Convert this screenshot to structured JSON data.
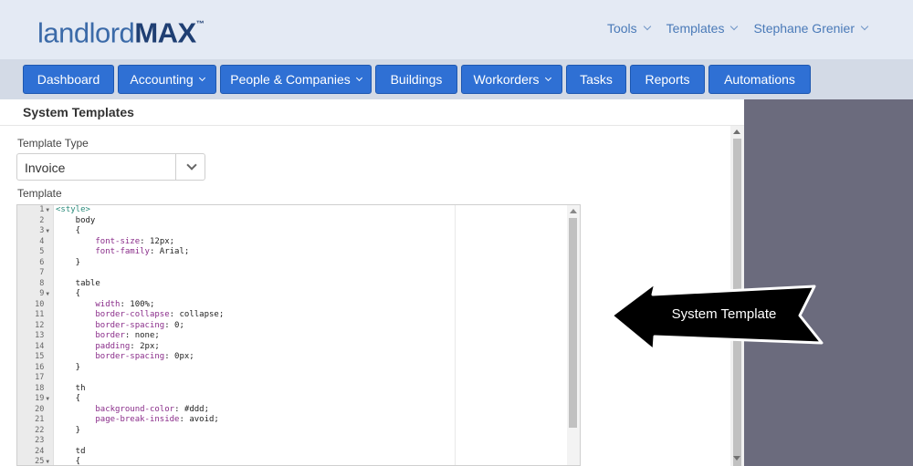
{
  "logo": {
    "light": "landlord",
    "bold": "MAX",
    "tm": "™"
  },
  "top_menu": [
    {
      "label": "Tools"
    },
    {
      "label": "Templates"
    },
    {
      "label": "Stephane Grenier"
    }
  ],
  "nav": [
    {
      "label": "Dashboard"
    },
    {
      "label": "Accounting"
    },
    {
      "label": "People & Companies"
    },
    {
      "label": "Buildings"
    },
    {
      "label": "Workorders"
    },
    {
      "label": "Tasks"
    },
    {
      "label": "Reports"
    },
    {
      "label": "Automations"
    }
  ],
  "panel": {
    "title": "System Templates",
    "template_type_label": "Template Type",
    "template_type_value": "Invoice",
    "template_label": "Template"
  },
  "editor": {
    "line_numbers": [
      "1",
      "2",
      "3",
      "4",
      "5",
      "6",
      "7",
      "8",
      "9",
      "10",
      "11",
      "12",
      "13",
      "14",
      "15",
      "16",
      "17",
      "18",
      "19",
      "20",
      "21",
      "22",
      "23",
      "24",
      "25"
    ],
    "lines": [
      "<style>",
      "    body",
      "    {",
      "        font-size: 12px;",
      "        font-family: Arial;",
      "    }",
      "",
      "    table",
      "    {",
      "        width: 100%;",
      "        border-collapse: collapse;",
      "        border-spacing: 0;",
      "        border: none;",
      "        padding: 2px;",
      "        border-spacing: 0px;",
      "    }",
      "",
      "    th",
      "    {",
      "        background-color: #ddd;",
      "        page-break-inside: avoid;",
      "    }",
      "",
      "    td",
      "    {"
    ]
  },
  "callout": {
    "text": "System Template"
  },
  "colors": {
    "nav_button": "#2f70d4",
    "header_bg": "#e4eaf4",
    "right_panel": "#6b6b7d"
  }
}
